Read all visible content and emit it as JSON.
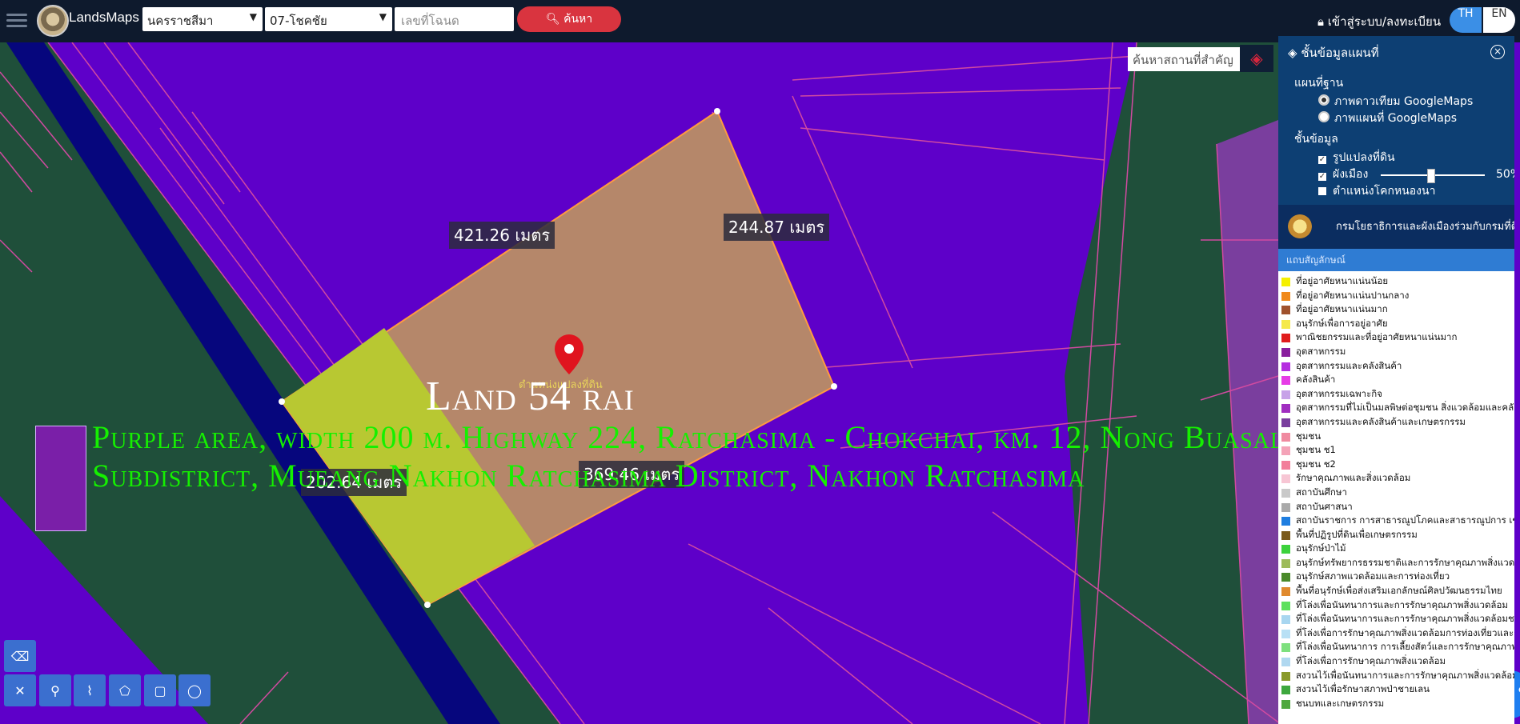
{
  "header": {
    "brand": "LandsMaps",
    "province": "นครราชสีมา",
    "district": "07-โชคชัย",
    "deed_placeholder": "เลขที่โฉนด",
    "search_label": "ค้นหา",
    "login_label": "เข้าสู่ระบบ/ลงทะเบียน",
    "lang_th": "TH",
    "lang_en": "EN"
  },
  "map": {
    "place_search_placeholder": "ค้นหาสถานที่สำคัญ",
    "edge_top": "421.26 เมตร",
    "edge_right": "244.87 เมตร",
    "edge_left": "202.64 เมตร",
    "edge_bottom": "369.46 เมตร",
    "pin_caption": "ตำแหน่งแปลงที่ดิน",
    "title": "Land 54 rai",
    "description": "Purple area, width 200 m. Highway 224, Ratchasima - Chokchai, km. 12, Nong Buasala Subdistrict, Mueang Nakhon Ratchasima District, Nakhon Ratchasima",
    "colors": {
      "purple_zone": "#5e00c9",
      "green_zone": "#1f4f3a",
      "parcel": "#b5876a",
      "road": "#06067d",
      "highlight": "#b8c832"
    }
  },
  "panel": {
    "title": "ชั้นข้อมูลแผนที่",
    "base_map_label": "แผนที่ฐาน",
    "base_options": [
      "ภาพดาวเทียม GoogleMaps",
      "ภาพแผนที่ GoogleMaps"
    ],
    "data_layers_label": "ชั้นข้อมูล",
    "layer_parcel": "รูปแปลงที่ดิน",
    "layer_cityplan": "ผังเมือง",
    "opacity": "50%",
    "layer_benchmark": "ตำแหน่งโคกหนองนา",
    "dept": "กรมโยธาธิการและผังเมืองร่วมกับกรมที่ดิน",
    "legend_title": "แถบสัญลักษณ์",
    "legend": [
      {
        "label": "ที่อยู่อาศัยหนาแน่นน้อย",
        "color": "#f5f000"
      },
      {
        "label": "ที่อยู่อาศัยหนาแน่นปานกลาง",
        "color": "#f08a1c"
      },
      {
        "label": "ที่อยู่อาศัยหนาแน่นมาก",
        "color": "#a0522d"
      },
      {
        "label": "อนุรักษ์เพื่อการอยู่อาศัย",
        "color": "#f5e94a"
      },
      {
        "label": "พาณิชยกรรมและที่อยู่อาศัยหนาแน่นมาก",
        "color": "#e01c1c"
      },
      {
        "label": "อุตสาหกรรม",
        "color": "#8a1e9e"
      },
      {
        "label": "อุตสาหกรรมและคลังสินค้า",
        "color": "#b52ee0"
      },
      {
        "label": "คลังสินค้า",
        "color": "#e63ce6"
      },
      {
        "label": "อุตสาหกรรมเฉพาะกิจ",
        "color": "#c7a2e8"
      },
      {
        "label": "อุตสาหกรรมที่ไม่เป็นมลพิษต่อชุมชน สิ่งแวดล้อมและคลังสินค้า",
        "color": "#a02ec0"
      },
      {
        "label": "อุตสาหกรรมและคลังสินค้าและเกษตรกรรม",
        "color": "#7a3e9e"
      },
      {
        "label": "ชุมชน",
        "color": "#f08aa0"
      },
      {
        "label": "ชุมชน ช1",
        "color": "#f4a3b8"
      },
      {
        "label": "ชุมชน ช2",
        "color": "#f27e9a"
      },
      {
        "label": "รักษาคุณภาพและสิ่งแวดล้อม",
        "color": "#f7c6d4"
      },
      {
        "label": "สถาบันศึกษา",
        "color": "#c9c9c9"
      },
      {
        "label": "สถาบันศาสนา",
        "color": "#aaaaaa"
      },
      {
        "label": "สถาบันราชการ การสาธารณูปโภคและสาธารณูปการ เขตทหาร",
        "color": "#1f7ee0"
      },
      {
        "label": "พื้นที่ปฏิรูปที่ดินเพื่อเกษตรกรรม",
        "color": "#7a5a1b"
      },
      {
        "label": "อนุรักษ์ป่าไม้",
        "color": "#3cd23c"
      },
      {
        "label": "อนุรักษ์ทรัพยากรธรรมชาติและการรักษาคุณภาพสิ่งแวดล้อม",
        "color": "#9dbb5a"
      },
      {
        "label": "อนุรักษ์สภาพแวดล้อมและการท่องเที่ยว",
        "color": "#4a8a2a"
      },
      {
        "label": "พื้นที่อนุรักษ์เพื่อส่งเสริมเอกลักษณ์ศิลปวัฒนธรรมไทย",
        "color": "#e08a2e"
      },
      {
        "label": "ที่โล่งเพื่อนันทนาการและการรักษาคุณภาพสิ่งแวดล้อม",
        "color": "#5de05d"
      },
      {
        "label": "ที่โล่งเพื่อนันทนาการและการรักษาคุณภาพสิ่งแวดล้อมชายฝั่ง",
        "color": "#a8d6f0"
      },
      {
        "label": "ที่โล่งเพื่อการรักษาคุณภาพสิ่งแวดล้อมการท่องเที่ยวและการ",
        "color": "#b8e0f5"
      },
      {
        "label": "ที่โล่งเพื่อนันทนาการ การเลี้ยงสัตว์และการรักษาคุณภาพสิ่งแ",
        "color": "#7ee07e"
      },
      {
        "label": "ที่โล่งเพื่อการรักษาคุณภาพสิ่งแวดล้อม",
        "color": "#b0d8f0"
      },
      {
        "label": "สงวนไว้เพื่อนันทนาการและการรักษาคุณภาพสิ่งแวดล้อม",
        "color": "#8a9a2a"
      },
      {
        "label": "สงวนไว้เพื่อรักษาสภาพป่าชายเลน",
        "color": "#3ea83e"
      },
      {
        "label": "ชนบทและเกษตรกรรม",
        "color": "#4fa83e"
      }
    ]
  }
}
